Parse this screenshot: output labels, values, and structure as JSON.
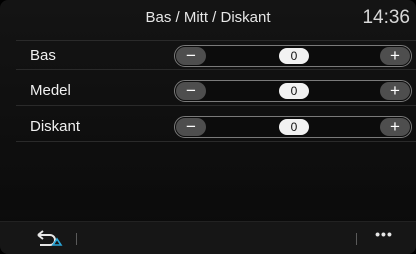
{
  "header": {
    "title": "Bas / Mitt / Diskant",
    "time": "14:36"
  },
  "rows": [
    {
      "label": "Bas",
      "value": "0",
      "minus": "−",
      "plus": "+"
    },
    {
      "label": "Medel",
      "value": "0",
      "minus": "−",
      "plus": "+"
    },
    {
      "label": "Diskant",
      "value": "0",
      "minus": "−",
      "plus": "+"
    }
  ],
  "footer": {
    "more": "•••",
    "back_icon": "back-arrow-icon",
    "more_icon": "more-options-icon"
  },
  "colors": {
    "accent": "#4e4e4e",
    "value_pill": "#f2f2f2",
    "back_icon_accent": "#2aa6d8"
  }
}
